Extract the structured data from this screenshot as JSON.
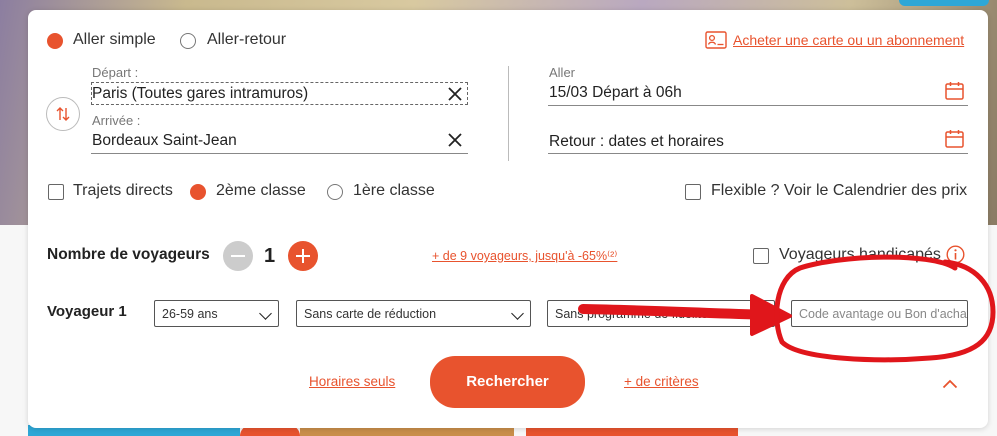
{
  "trip_type": {
    "one_way_label": "Aller simple",
    "round_trip_label": "Aller-retour",
    "selected": "one_way"
  },
  "card_link": "Acheter une carte ou un abonnement",
  "departure": {
    "label": "Départ :",
    "value": "Paris (Toutes gares intramuros)"
  },
  "arrival": {
    "label": "Arrivée :",
    "value": "Bordeaux Saint-Jean"
  },
  "outbound": {
    "label": "Aller",
    "value": "15/03 Départ à 06h"
  },
  "return": {
    "value": "Retour : dates et horaires"
  },
  "options": {
    "direct_label": "Trajets directs",
    "second_class_label": "2ème classe",
    "first_class_label": "1ère classe",
    "flexible_label": "Flexible ? Voir le Calendrier des prix",
    "selected_class": "2nd"
  },
  "travelers": {
    "label": "Nombre de voyageurs",
    "count": "1",
    "more_link": "+ de 9 voyageurs, jusqu'à -65%⁽²⁾",
    "disabled_label": "Voyageurs handicapés"
  },
  "traveler1": {
    "label": "Voyageur 1",
    "age": "26-59 ans",
    "card": "Sans carte de réduction",
    "program": "Sans programme de fidélité",
    "code_placeholder": "Code avantage ou Bon d'achat"
  },
  "footer": {
    "schedules_link": "Horaires seuls",
    "search_button": "Rechercher",
    "more_criteria_link": "+ de critères"
  },
  "colors": {
    "accent": "#e8532e",
    "annotation": "#e0161b"
  },
  "icons": [
    "swap-icon",
    "clear-icon",
    "calendar-icon",
    "card-icon",
    "info-icon",
    "chevron-up-icon",
    "chevron-down-icon",
    "minus-icon",
    "plus-icon"
  ]
}
